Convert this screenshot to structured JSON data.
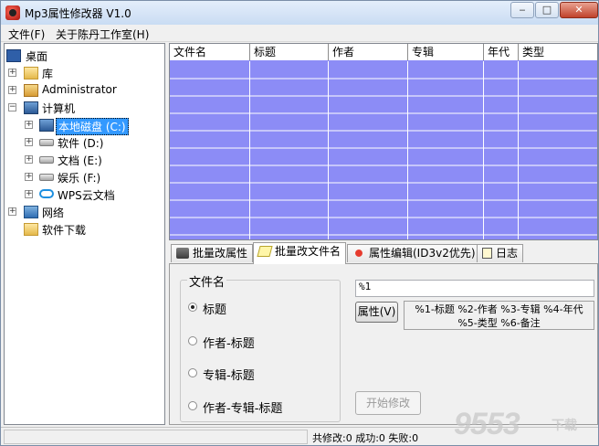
{
  "window": {
    "title": "Mp3属性修改器 V1.0",
    "min": "‒",
    "max": "□",
    "close": "✕"
  },
  "menu": {
    "file": "文件(F)",
    "about": "关于陈丹工作室(H)"
  },
  "tree": {
    "desktop": "桌面",
    "library": "库",
    "admin": "Administrator",
    "computer": "计算机",
    "drive_c": "本地磁盘 (C:)",
    "drive_d": "软件 (D:)",
    "drive_e": "文档 (E:)",
    "drive_f": "娱乐 (F:)",
    "wps": "WPS云文档",
    "network": "网络",
    "downloads": "软件下载",
    "expand": "+",
    "collapse": "−"
  },
  "grid": {
    "columns": [
      "文件名",
      "标题",
      "作者",
      "专辑",
      "年代",
      "类型"
    ],
    "row_color": "#8c8cf6",
    "line_color": "#ffffff"
  },
  "tabs": {
    "batch_attr": "批量改属性",
    "batch_name": "批量改文件名",
    "attr_edit": "属性编辑(ID3v2优先)",
    "log": "日志"
  },
  "panel": {
    "group_title": "文件名",
    "options": [
      "标题",
      "作者-标题",
      "专辑-标题",
      "作者-专辑-标题"
    ],
    "selected_index": 0,
    "pattern_value": "%1",
    "attr_button": "属性(V)",
    "help_line1": "%1-标题 %2-作者 %3-专辑 %4-年代",
    "help_line2": "%5-类型 %6-备注",
    "start_button": "开始修改"
  },
  "status": {
    "text": "共修改:0  成功:0  失败:0"
  },
  "watermark": {
    "main": "9553",
    "sub": "下载"
  }
}
